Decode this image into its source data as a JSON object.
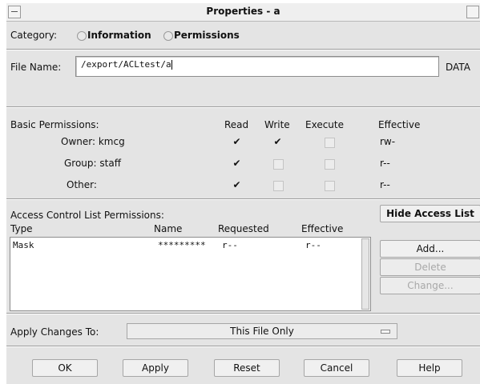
{
  "window": {
    "title": "Properties - a"
  },
  "category": {
    "label": "Category:",
    "options": [
      "Information",
      "Permissions"
    ],
    "selected": "Permissions"
  },
  "file": {
    "label": "File Name:",
    "value": "/export/ACLtest/a",
    "type_label": "DATA"
  },
  "basic": {
    "label": "Basic Permissions:",
    "headers": {
      "read": "Read",
      "write": "Write",
      "execute": "Execute",
      "effective": "Effective"
    },
    "rows": [
      {
        "label": "Owner:  kmcg",
        "read": true,
        "write": true,
        "execute": false,
        "effective": "rw-"
      },
      {
        "label": "Group:  staff",
        "read": true,
        "write": false,
        "execute": false,
        "effective": "r--"
      },
      {
        "label": "Other:",
        "read": true,
        "write": false,
        "execute": false,
        "effective": "r--"
      }
    ]
  },
  "acl": {
    "label": "Access Control List Permissions:",
    "hide_button": "Hide Access List",
    "headers": {
      "type": "Type",
      "name": "Name",
      "requested": "Requested",
      "effective": "Effective"
    },
    "rows": [
      {
        "type": "Mask",
        "name": "*********",
        "requested": "r--",
        "effective": "r--"
      }
    ],
    "buttons": {
      "add": "Add...",
      "delete": "Delete",
      "change": "Change..."
    }
  },
  "apply_to": {
    "label": "Apply Changes To:",
    "value": "This File Only"
  },
  "footer": {
    "ok": "OK",
    "apply": "Apply",
    "reset": "Reset",
    "cancel": "Cancel",
    "help": "Help"
  }
}
